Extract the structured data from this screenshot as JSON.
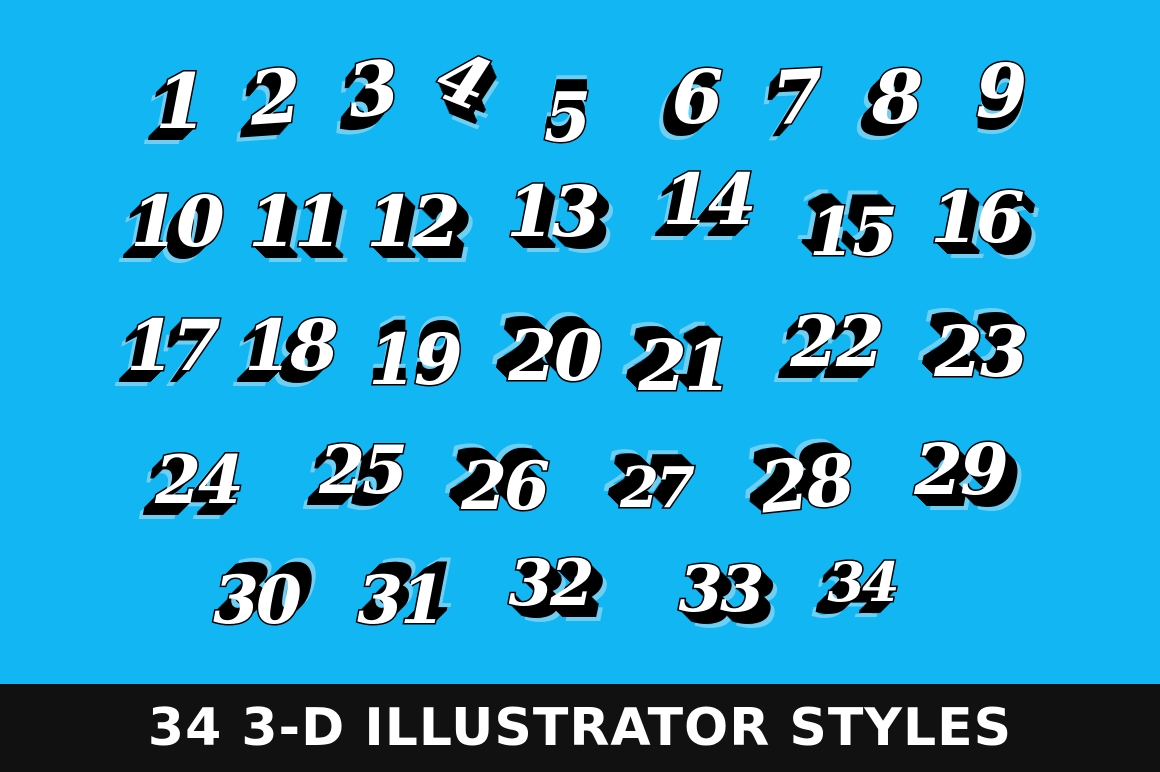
{
  "colors": {
    "background": "#12b6f3",
    "glyph_fill": "#ffffff",
    "glyph_outline": "#000000",
    "extrusion": "#000000",
    "shadow_halo": "#6fcff2",
    "banner_bg": "#111111",
    "banner_text": "#ffffff"
  },
  "numbers": [
    "1",
    "2",
    "3",
    "4",
    "5",
    "6",
    "7",
    "8",
    "9",
    "10",
    "11",
    "12",
    "13",
    "14",
    "15",
    "16",
    "17",
    "18",
    "19",
    "20",
    "21",
    "22",
    "23",
    "24",
    "25",
    "26",
    "27",
    "28",
    "29",
    "30",
    "31",
    "32",
    "33",
    "34"
  ],
  "banner": {
    "title": "34 3-D ILLUSTRATOR STYLES"
  }
}
